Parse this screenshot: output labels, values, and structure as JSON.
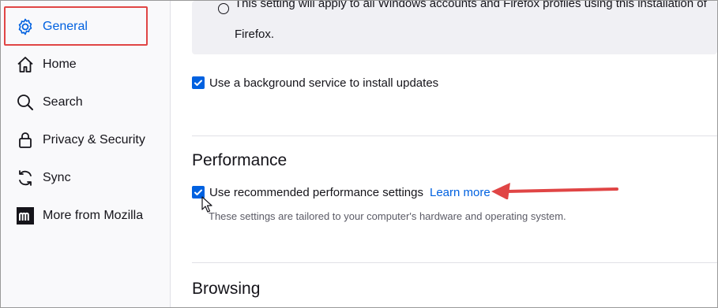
{
  "sidebar": {
    "items": [
      {
        "label": "General",
        "icon": "gear-icon",
        "selected": true
      },
      {
        "label": "Home",
        "icon": "home-icon"
      },
      {
        "label": "Search",
        "icon": "search-icon"
      },
      {
        "label": "Privacy & Security",
        "icon": "lock-icon"
      },
      {
        "label": "Sync",
        "icon": "sync-icon"
      },
      {
        "label": "More from Mozilla",
        "icon": "mozilla-logo-icon"
      }
    ]
  },
  "updates": {
    "notice_line1": "This setting will apply to all Windows accounts and Firefox profiles using this installation of",
    "notice_line2": "Firefox.",
    "background_service_label": "Use a background service to install updates",
    "background_service_checked": true
  },
  "performance": {
    "heading": "Performance",
    "recommended_label": "Use recommended performance settings",
    "recommended_checked": true,
    "learn_more": "Learn more",
    "hint": "These settings are tailored to your computer's hardware and operating system."
  },
  "browsing": {
    "heading": "Browsing"
  },
  "colors": {
    "accent": "#0061e0",
    "annotation": "#e04545"
  }
}
